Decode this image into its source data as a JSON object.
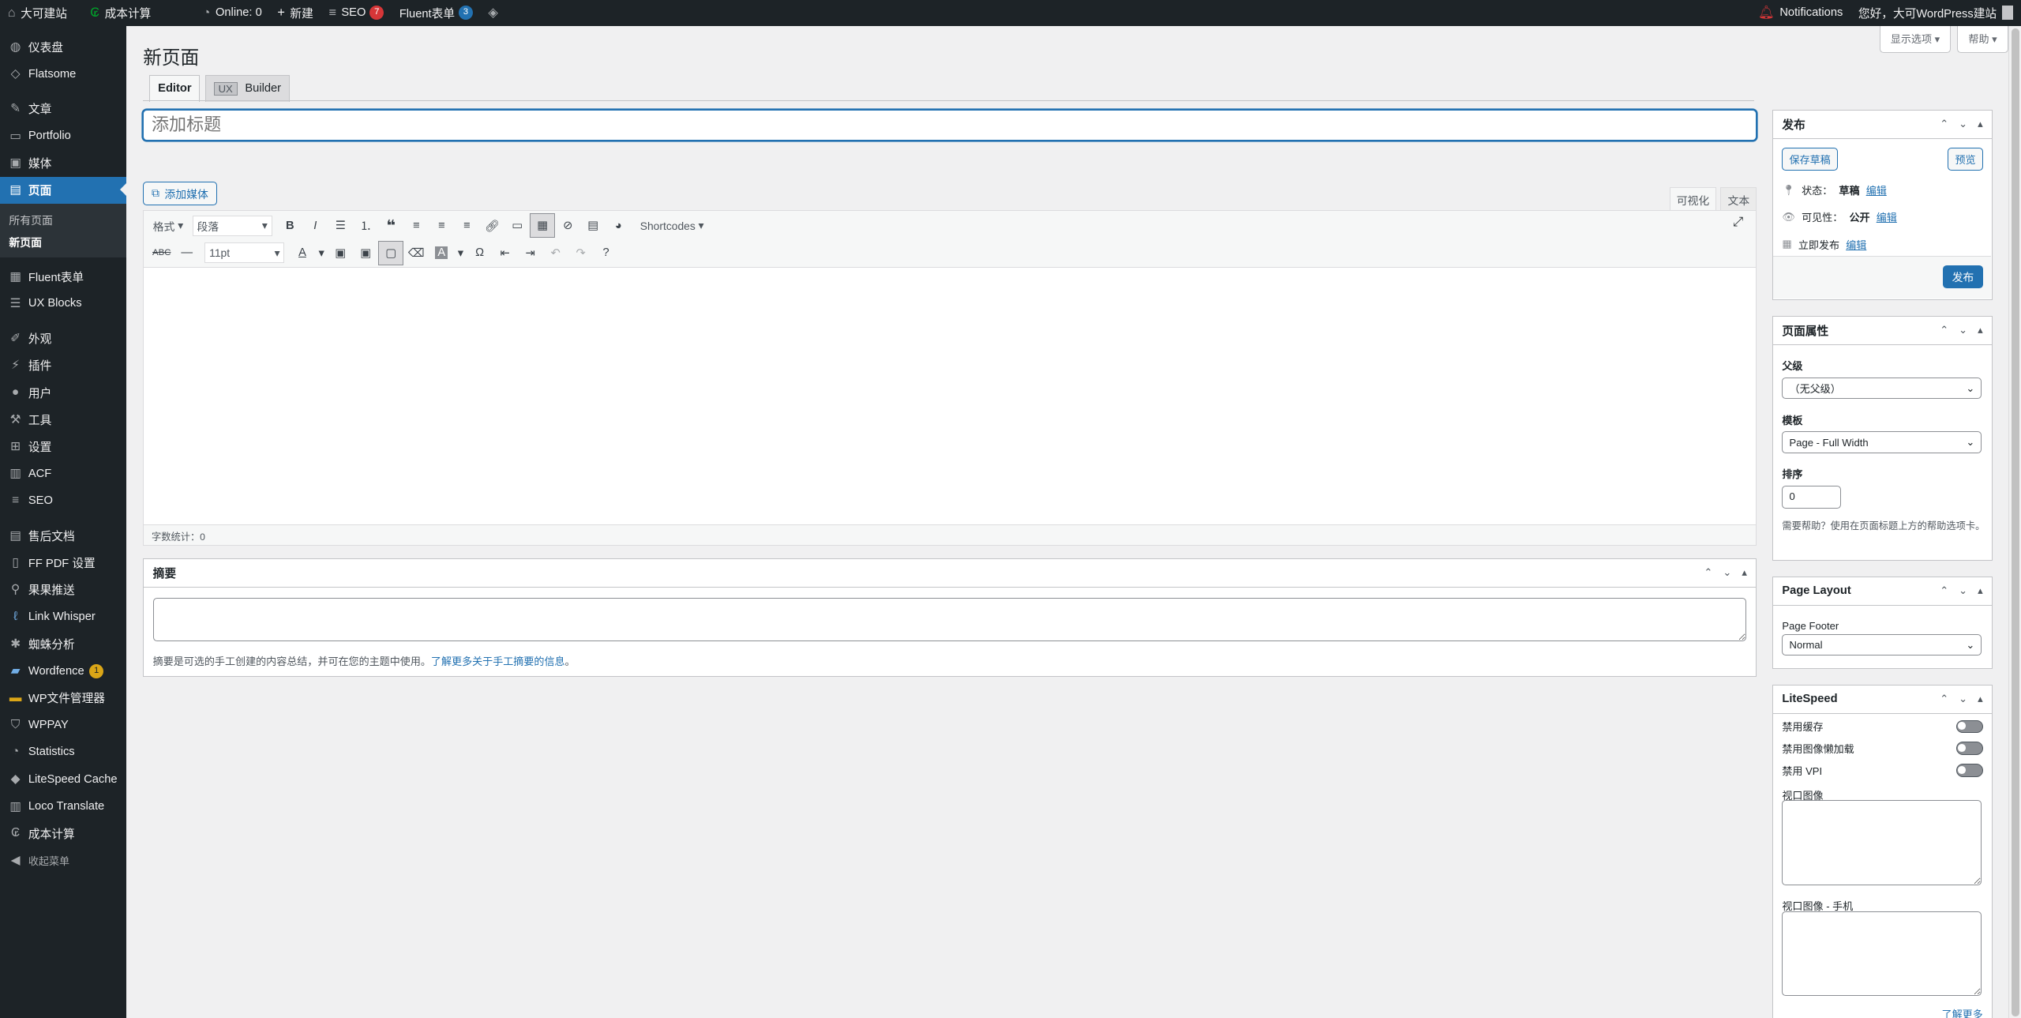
{
  "adminbar": {
    "site_name": "大可建站",
    "cost_calc": "成本计算",
    "online": "Online: 0",
    "new": "新建",
    "seo": "SEO",
    "seo_count": "7",
    "fluent": "Fluent表单",
    "fluent_count": "3",
    "notifications": "Notifications",
    "greeting": "您好，大可WordPress建站"
  },
  "sidebar": {
    "items": [
      {
        "label": "仪表盘",
        "icon": "dashboard-icon"
      },
      {
        "label": "Flatsome",
        "icon": "flatsome-icon"
      },
      {
        "label": "文章",
        "icon": "pin-icon"
      },
      {
        "label": "Portfolio",
        "icon": "portfolio-icon"
      },
      {
        "label": "媒体",
        "icon": "media-icon"
      },
      {
        "label": "页面",
        "icon": "page-icon"
      },
      {
        "label": "Fluent表单",
        "icon": "form-icon"
      },
      {
        "label": "UX Blocks",
        "icon": "blocks-icon"
      },
      {
        "label": "外观",
        "icon": "brush-icon"
      },
      {
        "label": "插件",
        "icon": "plugin-icon"
      },
      {
        "label": "用户",
        "icon": "user-icon"
      },
      {
        "label": "工具",
        "icon": "wrench-icon"
      },
      {
        "label": "设置",
        "icon": "settings-icon"
      },
      {
        "label": "ACF",
        "icon": "acf-icon"
      },
      {
        "label": "SEO",
        "icon": "seo-icon"
      },
      {
        "label": "售后文档",
        "icon": "docs-icon"
      },
      {
        "label": "FF PDF 设置",
        "icon": "pdf-icon"
      },
      {
        "label": "果果推送",
        "icon": "push-icon"
      },
      {
        "label": "Link Whisper",
        "icon": "link-icon"
      },
      {
        "label": "蜘蛛分析",
        "icon": "spider-icon"
      },
      {
        "label": "Wordfence",
        "icon": "wordfence-icon",
        "badge": "1"
      },
      {
        "label": "WP文件管理器",
        "icon": "file-manager-icon"
      },
      {
        "label": "WPPAY",
        "icon": "pay-icon"
      },
      {
        "label": "Statistics",
        "icon": "statistics-icon"
      },
      {
        "label": "LiteSpeed Cache",
        "icon": "litespeed-icon"
      },
      {
        "label": "Loco Translate",
        "icon": "translate-icon"
      },
      {
        "label": "成本计算",
        "icon": "calc-icon"
      },
      {
        "label": "收起菜单",
        "icon": "collapse-icon"
      }
    ],
    "submenu": {
      "all_pages": "所有页面",
      "new_page": "新页面"
    }
  },
  "header": {
    "screen_options": "显示选项 ▾",
    "help": "帮助 ▾",
    "title": "新页面",
    "tab_editor": "Editor",
    "tab_ux_logo": "UX",
    "tab_builder": "Builder"
  },
  "editor": {
    "title_placeholder": "添加标题",
    "add_media": "添加媒体",
    "tab_visual": "可视化",
    "tab_text": "文本",
    "format_label": "格式",
    "paragraph_label": "段落",
    "shortcodes_label": "Shortcodes",
    "font_size": "11pt",
    "word_count": "字数统计：0"
  },
  "excerpt": {
    "title": "摘要",
    "note": "摘要是可选的手工创建的内容总结，并可在您的主题中使用。",
    "link": "了解更多关于手工摘要的信息",
    "note_end": "。"
  },
  "publish": {
    "title": "发布",
    "save_draft": "保存草稿",
    "preview": "预览",
    "status_label": "状态：",
    "status_value": "草稿",
    "visibility_label": "可见性：",
    "visibility_value": "公开",
    "schedule": "立即发布",
    "edit": "编辑",
    "publish_button": "发布"
  },
  "page_attributes": {
    "title": "页面属性",
    "parent_label": "父级",
    "parent_value": "（无父级）",
    "template_label": "模板",
    "template_value": "Page - Full Width",
    "order_label": "排序",
    "order_value": "0",
    "help_text": "需要帮助？使用在页面标题上方的帮助选项卡。"
  },
  "page_layout": {
    "title": "Page Layout",
    "footer_label": "Page Footer",
    "footer_value": "Normal"
  },
  "litespeed": {
    "title": "LiteSpeed",
    "disable_cache": "禁用缓存",
    "disable_lazy": "禁用图像懒加载",
    "disable_vpi": "禁用 VPI",
    "viewport_image": "视口图像",
    "viewport_image_mobile": "视口图像 - 手机",
    "learn_more": "了解更多"
  },
  "colors": {
    "accent": "#2271b1",
    "adminbar": "#1d2327",
    "badge": "#d63638"
  }
}
